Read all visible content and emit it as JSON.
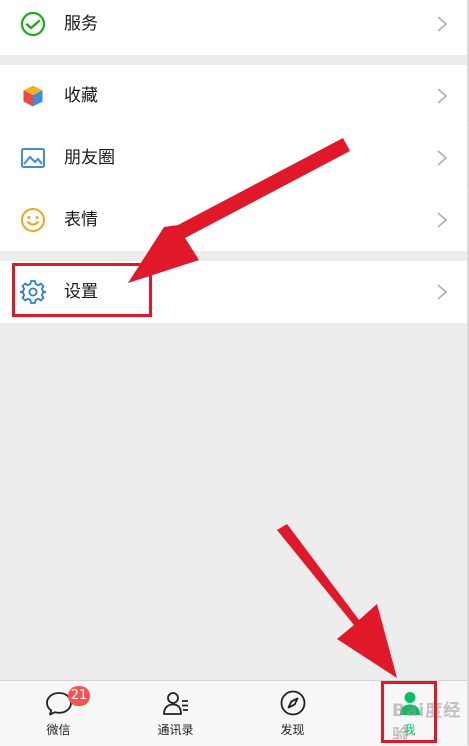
{
  "menu": {
    "services": "服务",
    "favorites": "收藏",
    "moments": "朋友圈",
    "stickers": "表情",
    "settings": "设置"
  },
  "tabbar": {
    "chats": "微信",
    "chats_badge": "21",
    "contacts": "通讯录",
    "discover": "发现",
    "me": "我"
  },
  "watermark": "Bai度经验",
  "colors": {
    "accent_green": "#07c160",
    "badge_red": "#fa5151",
    "annotation_red": "#e0182a",
    "settings_icon_blue": "#2f7fd7"
  }
}
